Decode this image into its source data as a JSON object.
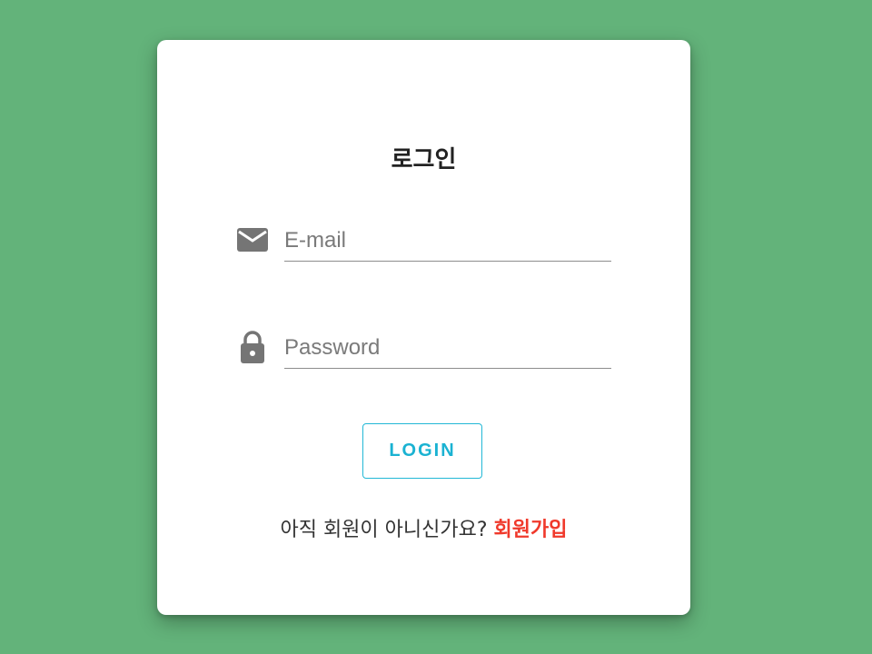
{
  "login": {
    "title": "로그인",
    "email": {
      "placeholder": "E-mail",
      "value": "",
      "icon": "mail-icon"
    },
    "password": {
      "placeholder": "Password",
      "value": "",
      "icon": "lock-icon"
    },
    "button_label": "LOGIN",
    "signup_prompt": "아직 회원이 아니신가요?",
    "signup_link": "회원가입"
  },
  "colors": {
    "background": "#63b37a",
    "card": "#ffffff",
    "accent": "#1ab2d2",
    "link": "#f0392b",
    "icon": "#757575"
  }
}
